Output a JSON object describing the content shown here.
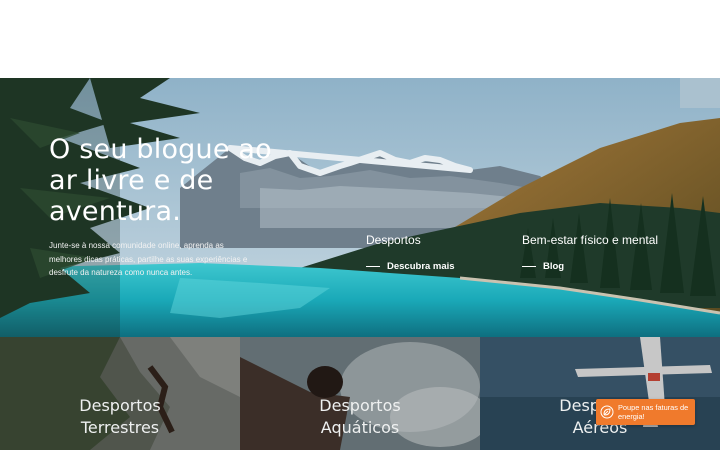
{
  "hero": {
    "title": "O seu blogue ao ar livre e de aventura.",
    "description": "Junte-se à nossa comunidade online, aprenda as melhores dicas práticas, partilhe as suas experiências e desfrute da natureza como nunca antes."
  },
  "categories": [
    {
      "title": "Desportos",
      "link": "Descubra mais"
    },
    {
      "title": "Bem-estar físico e mental",
      "link": "Blog"
    }
  ],
  "tiles": [
    {
      "label_line1": "Desportos",
      "label_line2": "Terrestres"
    },
    {
      "label_line1": "Desportos",
      "label_line2": "Aquáticos"
    },
    {
      "label_line1": "Desportos",
      "label_line2": "Aéreos"
    }
  ],
  "promo": {
    "text": "Poupe nas faturas de energia!",
    "icon": "leaf-icon"
  },
  "colors": {
    "promo_bg": "#f07a2c",
    "lake": "#1fb8c6"
  }
}
